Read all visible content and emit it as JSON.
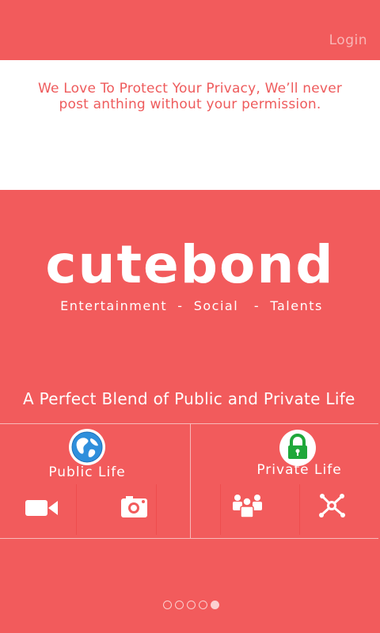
{
  "header": {
    "login_label": "Login"
  },
  "privacy": {
    "line1": "We Love To Protect Your Privacy, We’ll never",
    "line2": "post anthing without your permission."
  },
  "hero": {
    "brand": "cutebond",
    "tagline": "Entertainment  -  Social   -  Talents",
    "subtitle": "A Perfect Blend of Public and Private Life"
  },
  "sections": {
    "public": {
      "label": "Public Life",
      "icon": "globe-icon",
      "features": [
        "video-camera-icon",
        "photo-camera-icon"
      ]
    },
    "private": {
      "label": "Private Life",
      "icon": "lock-icon",
      "features": [
        "group-icon",
        "network-icon"
      ]
    }
  },
  "pager": {
    "count": 5,
    "active_index": 4
  },
  "colors": {
    "primary": "#f25b5c",
    "white": "#ffffff",
    "lock_green": "#1fa83a",
    "globe_blue": "#2f8fdc"
  }
}
